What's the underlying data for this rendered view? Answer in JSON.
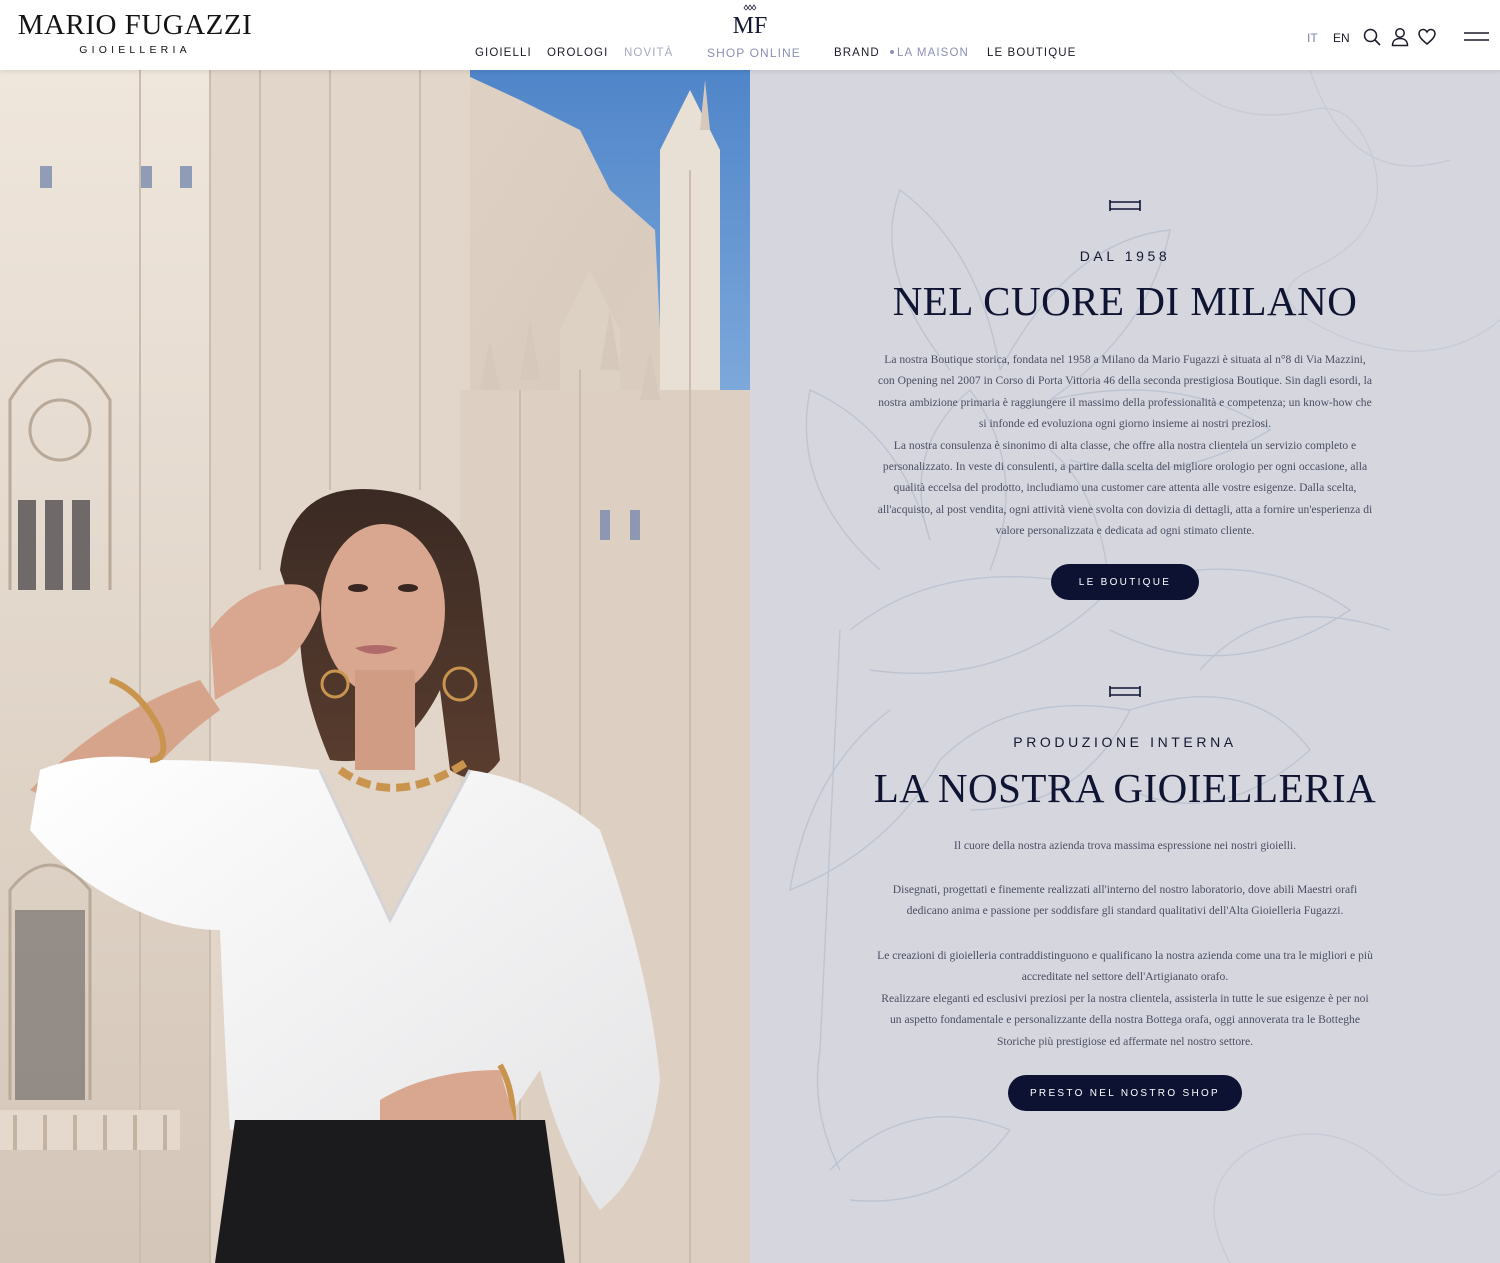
{
  "header": {
    "brand_name": "MARIO FUGAZZI",
    "brand_sub": "GIOIELLERIA",
    "logo_monogram": "MF",
    "nav": {
      "gioielli": "GIOIELLI",
      "orologi": "OROLOGI",
      "novita": "NOVITÀ",
      "shop_online": "SHOP ONLINE",
      "brand": "BRAND",
      "la_maison": "LA MAISON",
      "le_boutique": "LE BOUTIQUE"
    },
    "lang_it": "IT",
    "lang_en": "EN",
    "icons": [
      "search-icon",
      "user-icon",
      "heart-icon",
      "menu-icon"
    ]
  },
  "section1": {
    "eyebrow": "DAL 1958",
    "title": "NEL CUORE DI MILANO",
    "lines": [
      "La nostra Boutique storica, fondata nel 1958 a Milano da Mario Fugazzi è situata al n°8 di Via Mazzini,",
      "con Opening nel 2007 in Corso di Porta Vittoria 46 della seconda prestigiosa Boutique. Sin dagli esordi, la",
      "nostra ambizione primaria è raggiungere il massimo della professionalità e competenza; un know-how che",
      "si infonde ed evoluziona ogni giorno insieme ai nostri preziosi.",
      "La nostra consulenza è sinonimo di alta classe, che offre alla nostra clientela un servizio completo e",
      "personalizzato. In veste di consulenti, a partire dalla scelta del migliore orologio per ogni occasione, alla",
      "qualità eccelsa del prodotto, includiamo una customer care attenta alle vostre esigenze. Dalla scelta,",
      "all'acquisto, al post vendita, ogni attività viene svolta con dovizia di dettagli, atta a fornire un'esperienza di",
      "valore personalizzata e dedicata ad ogni stimato cliente."
    ],
    "button": "LE BOUTIQUE"
  },
  "section2": {
    "eyebrow": "PRODUZIONE INTERNA",
    "title": "LA NOSTRA GIOIELLERIA",
    "intro": "Il cuore della nostra azienda trova massima espressione nei nostri gioielli.",
    "lines_a": [
      "Disegnati, progettati e finemente realizzati all'interno del nostro laboratorio, dove abili Maestri orafi",
      "dedicano anima e passione per soddisfare gli standard qualitativi dell'Alta Gioielleria Fugazzi."
    ],
    "lines_b": [
      "Le creazioni di gioielleria contraddistinguono e qualificano la nostra azienda come una tra le migliori e più",
      "accreditate nel settore dell'Artigianato orafo.",
      "Realizzare eleganti ed esclusivi preziosi per la nostra clientela, assisterla in tutte le sue esigenze è per noi",
      "un aspetto fondamentale e personalizzante della nostra Bottega orafa, oggi annoverata tra le Botteghe",
      "Storiche più prestigiose ed affermate nel nostro settore."
    ],
    "button": "PRESTO NEL NOSTRO SHOP"
  },
  "colors": {
    "navy": "#0d1232",
    "panel_bg": "#d5d6de",
    "accent": "#8b8fb5"
  }
}
